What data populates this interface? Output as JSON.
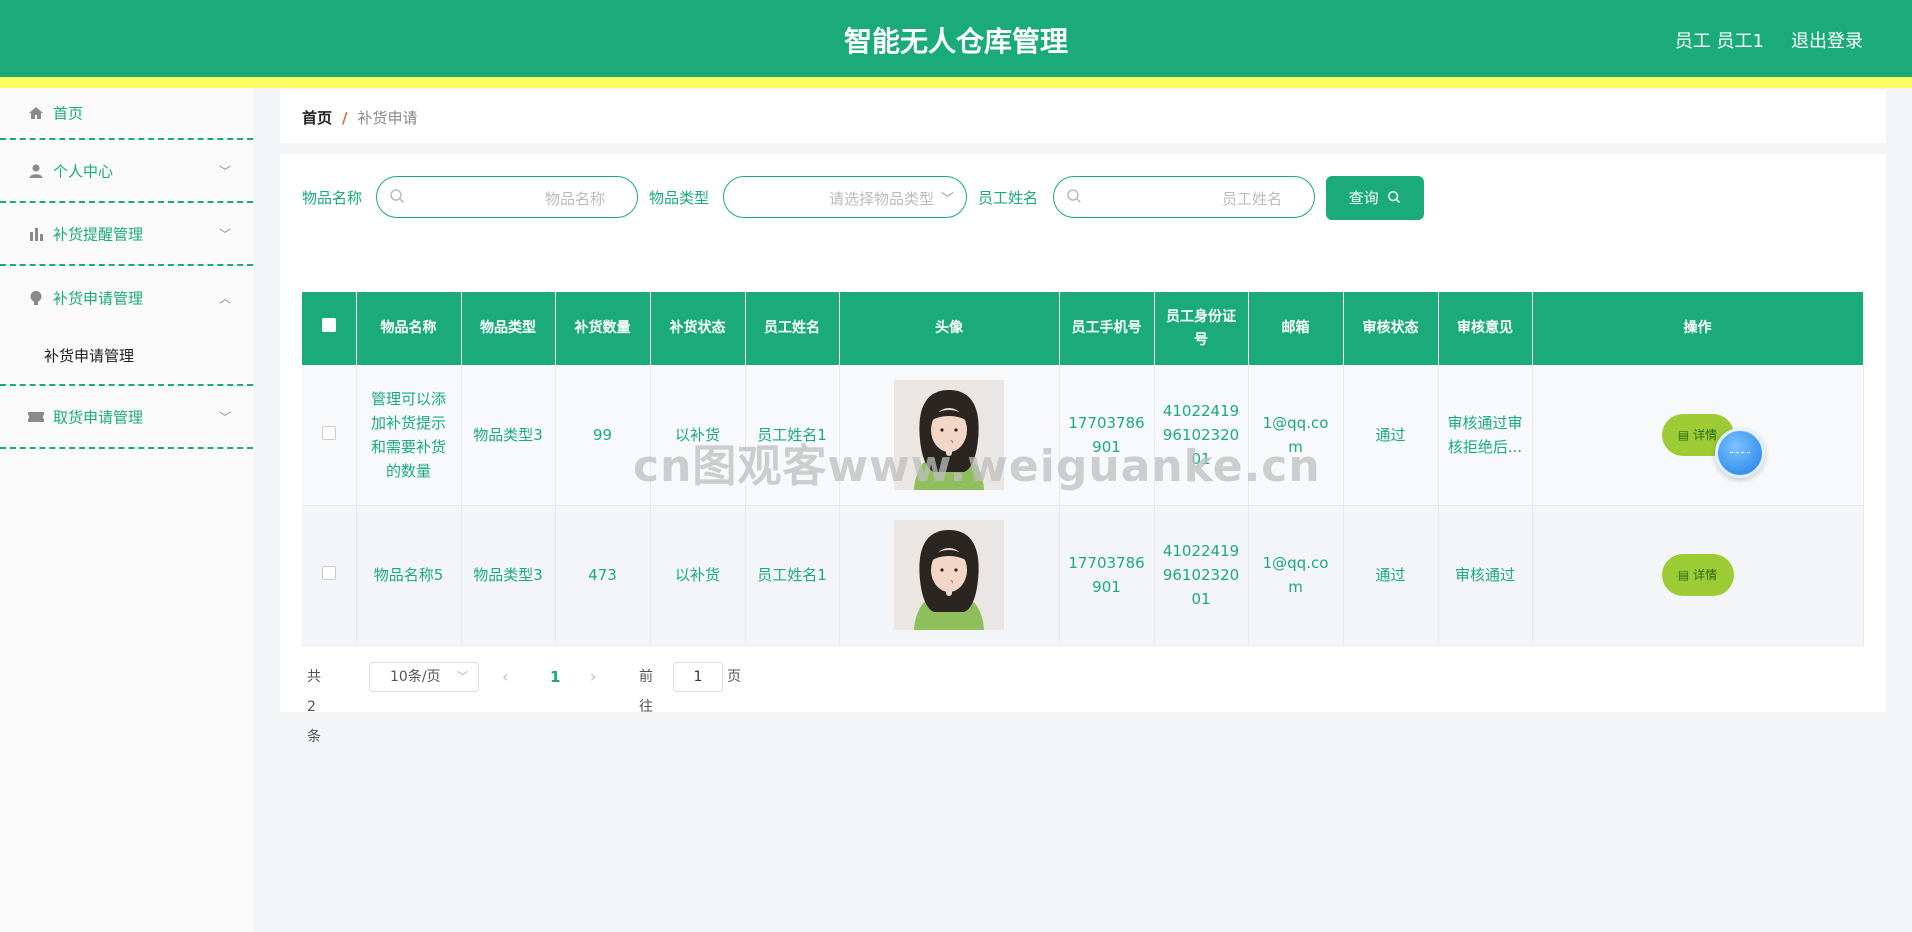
{
  "header": {
    "title": "智能无人仓库管理",
    "user": "员工 员工1",
    "logout": "退出登录"
  },
  "sidebar": {
    "home": "首页",
    "personal": "个人中心",
    "restock_reminder": "补货提醒管理",
    "restock_apply": "补货申请管理",
    "restock_apply_sub": "补货申请管理",
    "pickup_apply": "取货申请管理"
  },
  "breadcrumb": {
    "home": "首页",
    "sep": "/",
    "current": "补货申请"
  },
  "search": {
    "name_label": "物品名称",
    "name_placeholder": "物品名称",
    "type_label": "物品类型",
    "type_placeholder": "请选择物品类型",
    "staff_label": "员工姓名",
    "staff_placeholder": "员工姓名",
    "query_button": "查询"
  },
  "table": {
    "headers": [
      "物品名称",
      "物品类型",
      "补货数量",
      "补货状态",
      "员工姓名",
      "头像",
      "员工手机号",
      "员工身份证号",
      "邮箱",
      "审核状态",
      "审核意见",
      "操作"
    ],
    "rows": [
      {
        "name": "管理可以添加补货提示和需要补货的数量",
        "type": "物品类型3",
        "qty": "99",
        "status": "以补货",
        "staff": "员工姓名1",
        "phone": "17703786901",
        "idcard": "410224199610232001",
        "email": "1@qq.com",
        "audit_status": "通过",
        "audit_opinion": "审核通过审核拒绝后...",
        "action": "详情"
      },
      {
        "name": "物品名称5",
        "type": "物品类型3",
        "qty": "473",
        "status": "以补货",
        "staff": "员工姓名1",
        "phone": "17703786901",
        "idcard": "410224199610232001",
        "email": "1@qq.com",
        "audit_status": "通过",
        "audit_opinion": "审核通过",
        "action": "详情"
      }
    ]
  },
  "pagination": {
    "total": "共 2 条",
    "page_size": "10条/页",
    "current_page": "1",
    "goto_label": "前往",
    "goto_value": "1",
    "page_suffix": "页"
  },
  "watermark": "cn图观客www.weiguanke.cn",
  "colors": {
    "primary": "#1bab7b",
    "stripe": "#f9fd62",
    "detail_button": "#9ccb34"
  }
}
